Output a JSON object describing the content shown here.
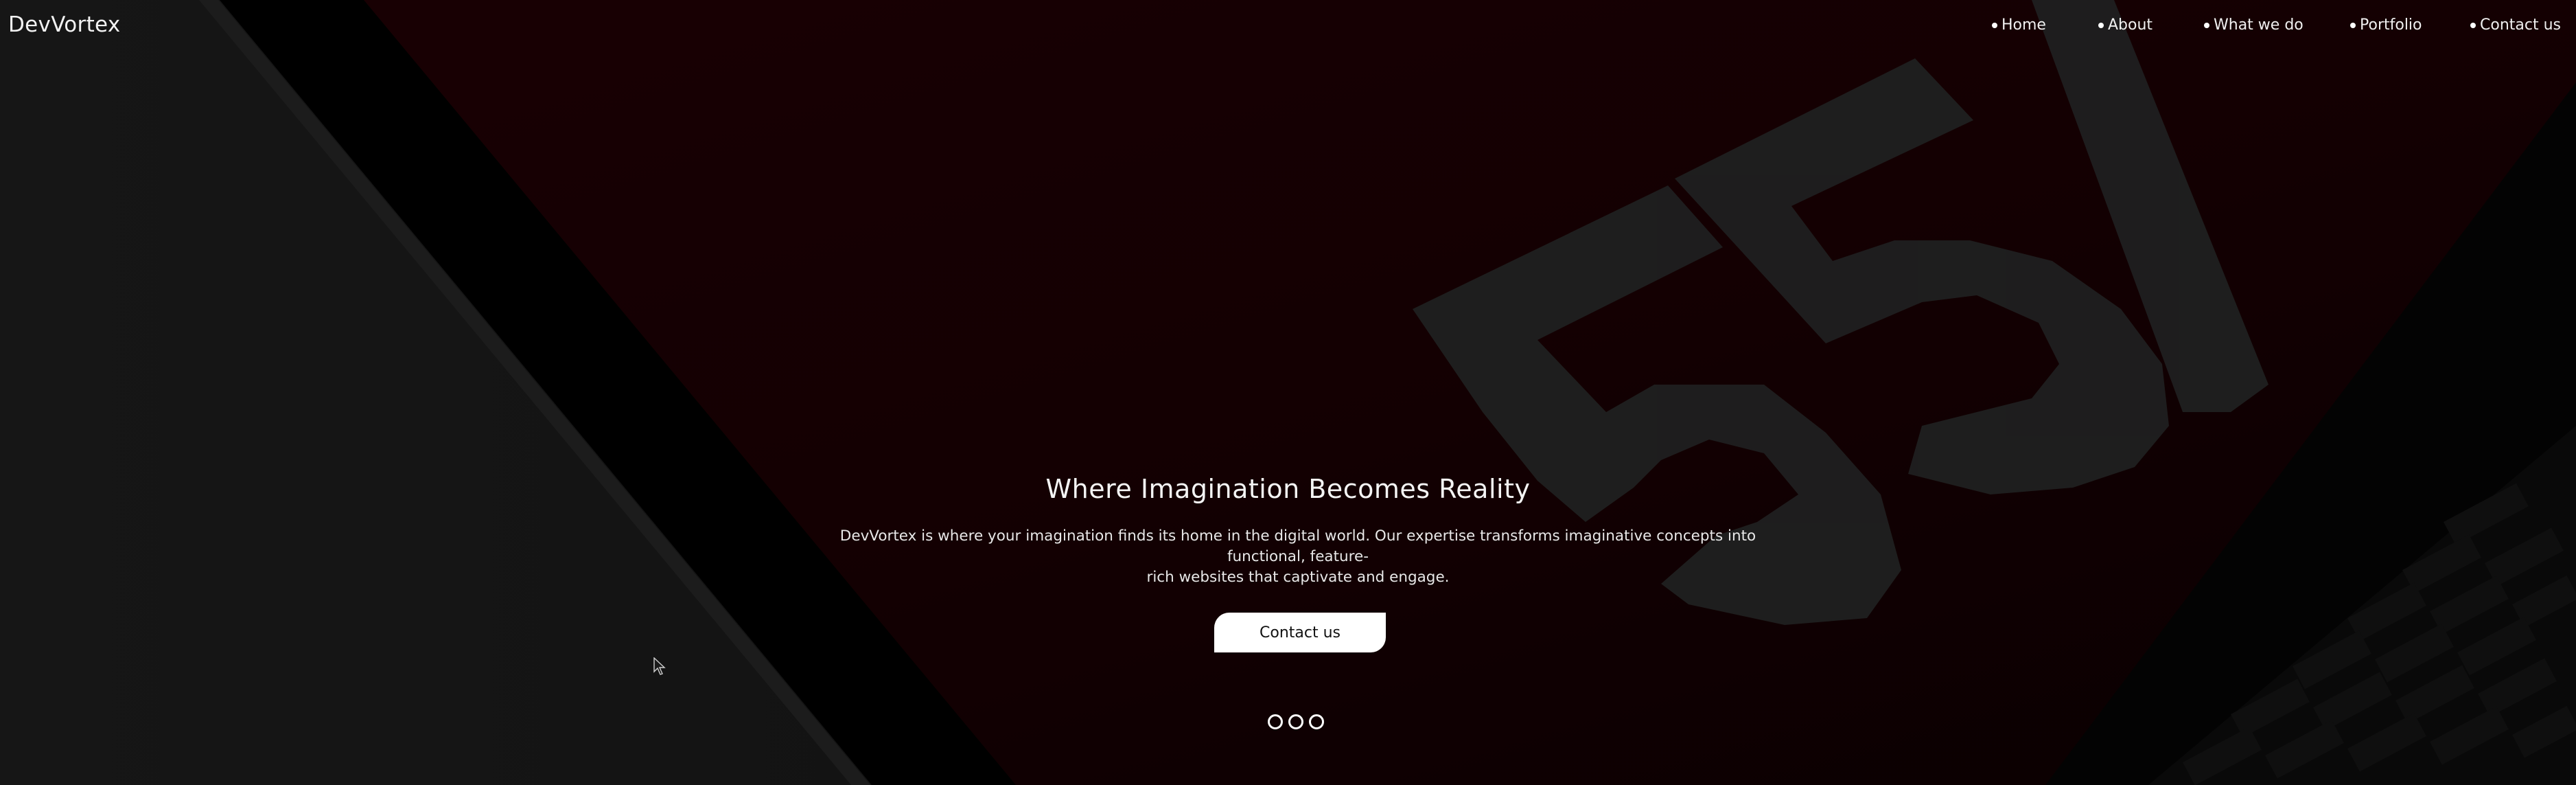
{
  "header": {
    "brand": "DevVortex",
    "nav": [
      {
        "label": "Home"
      },
      {
        "label": "About"
      },
      {
        "label": "What we do"
      },
      {
        "label": "Portfolio"
      },
      {
        "label": "Contact us"
      }
    ]
  },
  "hero": {
    "title": "Where Imagination Becomes Reality",
    "description_line1": "DevVortex is where your imagination finds its home in the digital world. Our expertise transforms imaginative concepts into functional, feature-",
    "description_line2": "rich websites that captivate and engage.",
    "cta_label": "Contact us",
    "background_text": "55I"
  },
  "slider": {
    "count": 3
  },
  "colors": {
    "accent_background": "#1d0004",
    "dark_panel": "#1c1c1c",
    "text": "#ffffff"
  }
}
